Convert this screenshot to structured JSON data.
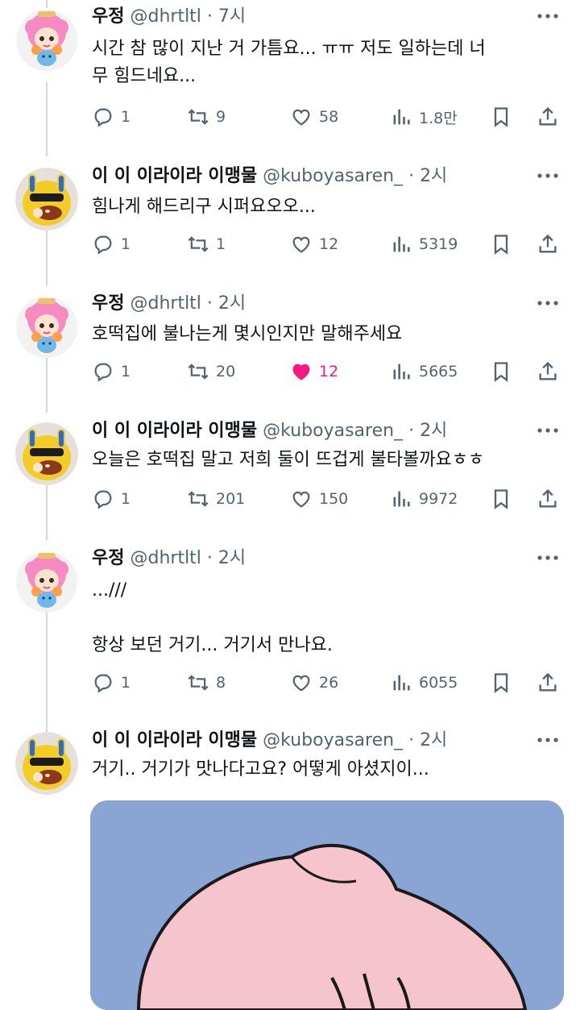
{
  "tweets": [
    {
      "name": "우정",
      "handle": "@dhrtltl",
      "time": "7시",
      "text": "시간 참 많이 지난 거 가틈요... ㅠㅠ 저도 일하는데 너\n무 힘드네요...",
      "replies": "1",
      "retweets": "9",
      "likes": "58",
      "views": "1.8만",
      "liked": false,
      "avatar": "pink-girl-avatar"
    },
    {
      "name": "이 이 이라이라 이맹물",
      "handle": "@kuboyasaren_",
      "time": "2시",
      "text": "힘나게 해드리구 시퍼요오오...",
      "replies": "1",
      "retweets": "1",
      "likes": "12",
      "views": "5319",
      "liked": false,
      "avatar": "yellow-character-avatar"
    },
    {
      "name": "우정",
      "handle": "@dhrtltl",
      "time": "2시",
      "text": "호떡집에 불나는게 몇시인지만 말해주세요",
      "replies": "1",
      "retweets": "20",
      "likes": "12",
      "views": "5665",
      "liked": true,
      "avatar": "pink-girl-avatar"
    },
    {
      "name": "이 이 이라이라 이맹물",
      "handle": "@kuboyasaren_",
      "time": "2시",
      "text": "오늘은 호떡집 말고 저희 둘이 뜨겁게 불타볼까요ㅎㅎ",
      "replies": "1",
      "retweets": "201",
      "likes": "150",
      "views": "9972",
      "liked": false,
      "avatar": "yellow-character-avatar"
    },
    {
      "name": "우정",
      "handle": "@dhrtltl",
      "time": "2시",
      "text": "...///\n\n항상 보던 거기... 거기서 만나요.",
      "replies": "1",
      "retweets": "8",
      "likes": "26",
      "views": "6055",
      "liked": false,
      "avatar": "pink-girl-avatar"
    },
    {
      "name": "이 이 이라이라 이맹물",
      "handle": "@kuboyasaren_",
      "time": "2시",
      "text": "거기.. 거기가 맛나다고요? 어떻게 아셨지이...",
      "avatar": "yellow-character-avatar",
      "media": "peach-character-image"
    }
  ],
  "separator": "·",
  "colors": {
    "liked": "#f91880",
    "secondary": "#536471",
    "thread_line": "#cfd9de",
    "media_bg": "#8aa5d4"
  }
}
